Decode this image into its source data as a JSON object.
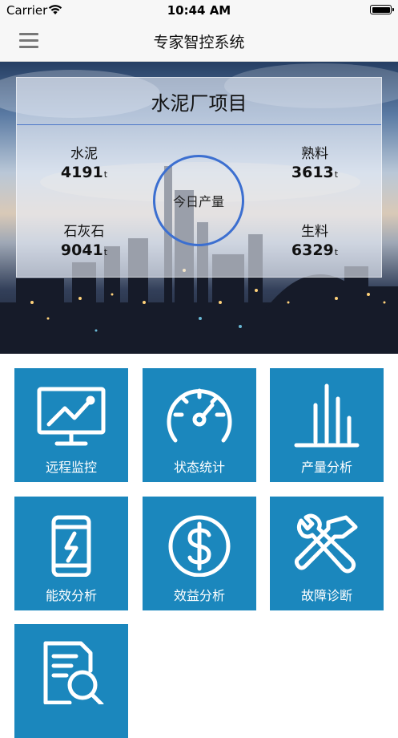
{
  "status_bar": {
    "carrier": "Carrier",
    "time": "10:44 AM"
  },
  "nav": {
    "title": "专家智控系统",
    "menu_icon": "hamburger-menu-icon"
  },
  "hero": {
    "project_title": "水泥厂项目",
    "center_label": "今日产量",
    "stats": [
      {
        "label": "水泥",
        "value": "4191",
        "unit": "t"
      },
      {
        "label": "熟料",
        "value": "3613",
        "unit": "t"
      },
      {
        "label": "石灰石",
        "value": "9041",
        "unit": "t"
      },
      {
        "label": "生料",
        "value": "6329",
        "unit": "t"
      }
    ]
  },
  "menu": [
    {
      "label": "远程监控",
      "icon": "monitor-chart-icon"
    },
    {
      "label": "状态统计",
      "icon": "gauge-icon"
    },
    {
      "label": "产量分析",
      "icon": "bar-chart-icon"
    },
    {
      "label": "能效分析",
      "icon": "battery-bolt-icon"
    },
    {
      "label": "效益分析",
      "icon": "dollar-icon"
    },
    {
      "label": "故障诊断",
      "icon": "tools-icon"
    },
    {
      "label": "",
      "icon": "document-search-icon"
    }
  ],
  "colors": {
    "tile": "#1b87bd",
    "ring": "#3c6fd0",
    "nav_bg": "#f7f7f7"
  }
}
